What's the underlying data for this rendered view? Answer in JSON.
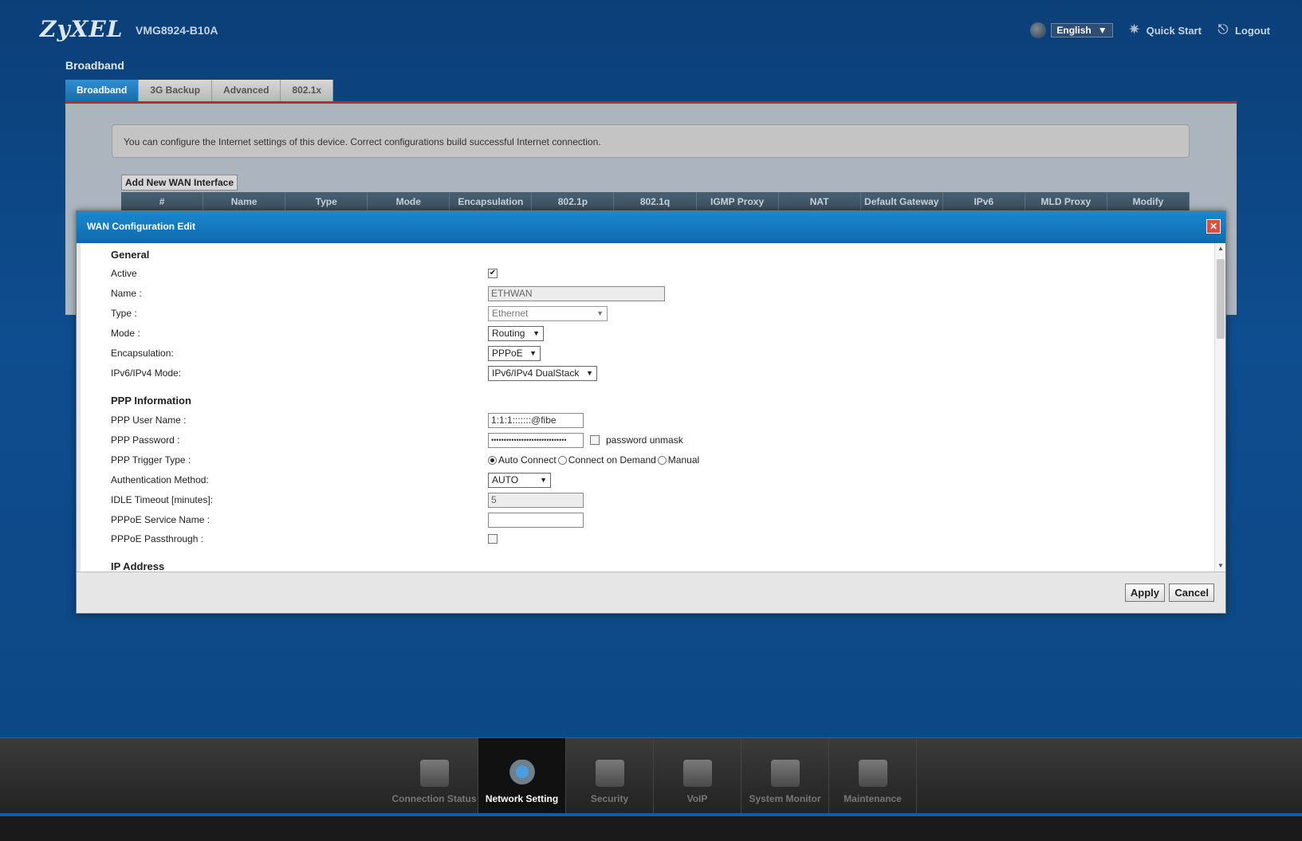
{
  "header": {
    "brand": "ZyXEL",
    "model": "VMG8924-B10A",
    "language": "English",
    "quick_start": "Quick Start",
    "logout": "Logout"
  },
  "page": {
    "title": "Broadband",
    "tabs": [
      {
        "label": "Broadband",
        "active": true
      },
      {
        "label": "3G Backup",
        "active": false
      },
      {
        "label": "Advanced",
        "active": false
      },
      {
        "label": "802.1x",
        "active": false
      }
    ],
    "info": "You can configure the Internet settings of this device. Correct configurations build successful Internet connection.",
    "add_button": "Add New WAN Interface",
    "table_headers": [
      "#",
      "Name",
      "Type",
      "Mode",
      "Encapsulation",
      "802.1p",
      "802.1q",
      "IGMP Proxy",
      "NAT",
      "Default Gateway",
      "IPv6",
      "MLD Proxy",
      "Modify"
    ]
  },
  "dialog": {
    "title": "WAN Configuration Edit",
    "general": {
      "heading": "General",
      "active_label": "Active",
      "active_checked": true,
      "name_label": "Name :",
      "name_value": "ETHWAN",
      "type_label": "Type :",
      "type_value": "Ethernet",
      "mode_label": "Mode :",
      "mode_value": "Routing",
      "encap_label": "Encapsulation:",
      "encap_value": "PPPoE",
      "ipmode_label": "IPv6/IPv4 Mode:",
      "ipmode_value": "IPv6/IPv4 DualStack"
    },
    "ppp": {
      "heading": "PPP Information",
      "user_label": "PPP User Name :",
      "user_value": "1:1:1:::::::@fibe",
      "password_label": "PPP Password :",
      "password_value": "••••••••••••••••••••••••••••••",
      "unmask_label": "password unmask",
      "trigger_label": "PPP Trigger Type :",
      "trigger_options": [
        "Auto Connect",
        "Connect on Demand",
        "Manual"
      ],
      "trigger_selected": "Auto Connect",
      "auth_label": "Authentication Method:",
      "auth_value": "AUTO",
      "idle_label": "IDLE Timeout [minutes]:",
      "idle_value": "5",
      "service_label": "PPPoE Service Name :",
      "service_value": "",
      "passthrough_label": "PPPoE Passthrough :",
      "passthrough_checked": false
    },
    "ip_heading": "IP Address",
    "apply": "Apply",
    "cancel": "Cancel"
  },
  "bottom_nav": [
    {
      "label": "Connection Status",
      "icon": "monitor-icon",
      "active": false
    },
    {
      "label": "Network Setting",
      "icon": "globe-network-icon",
      "active": true
    },
    {
      "label": "Security",
      "icon": "shield-icon",
      "active": false
    },
    {
      "label": "VoIP",
      "icon": "phone-icon",
      "active": false
    },
    {
      "label": "System Monitor",
      "icon": "chart-monitor-icon",
      "active": false
    },
    {
      "label": "Maintenance",
      "icon": "tools-icon",
      "active": false
    }
  ]
}
